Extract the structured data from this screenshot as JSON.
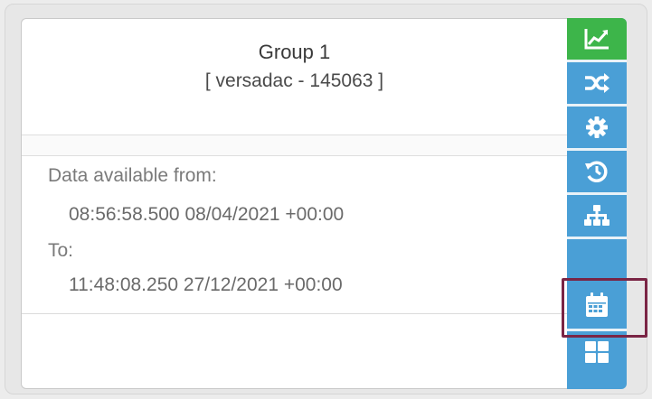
{
  "card": {
    "title": "Group 1",
    "subtitle": "[ versadac - 145063 ]",
    "available_from_label": "Data available from:",
    "available_from_value": "08:56:58.500 08/04/2021 +00:00",
    "to_label": "To:",
    "to_value": "11:48:08.250 27/12/2021 +00:00"
  },
  "toolbar": {
    "buttons": [
      {
        "icon": "line-chart-icon",
        "state": "active"
      },
      {
        "icon": "shuffle-icon",
        "state": "default"
      },
      {
        "icon": "gear-icon",
        "state": "default"
      },
      {
        "icon": "history-icon",
        "state": "default"
      },
      {
        "icon": "sitemap-icon",
        "state": "default"
      },
      {
        "icon": "calendar-icon",
        "state": "highlighted"
      },
      {
        "icon": "grid-icon",
        "state": "default"
      }
    ]
  },
  "colors": {
    "active_green": "#3db54a",
    "toolbar_blue": "#4a9fd6",
    "highlight_border": "#7a2545"
  }
}
